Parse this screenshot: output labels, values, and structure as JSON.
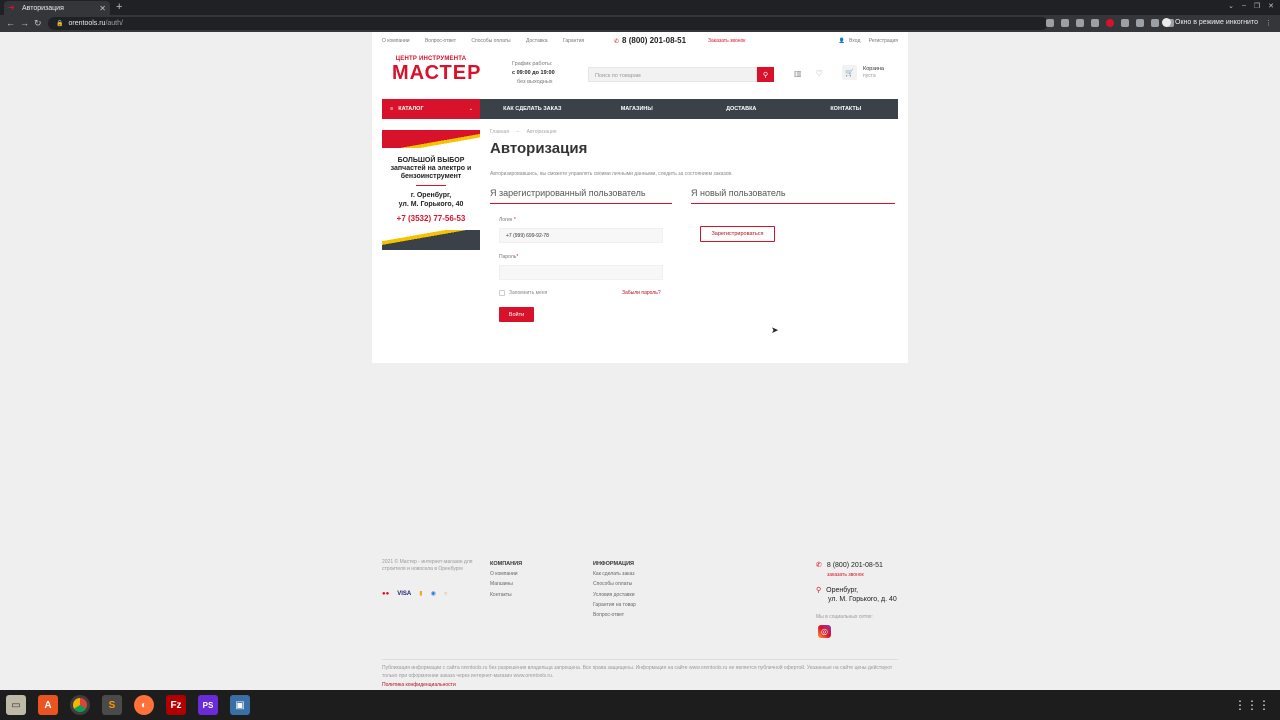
{
  "browser": {
    "tab_title": "Авторизация",
    "url_host": "orentools.ru",
    "url_path": "/auth/",
    "incognito_label": "Окно в режиме инкогнито"
  },
  "topbar": {
    "links": [
      "О компании",
      "Вопрос-ответ",
      "Способы оплаты",
      "Доставка",
      "Гарантия"
    ],
    "phone": "8 (800) 201-08-51",
    "callback": "Заказать звонок",
    "login": "Вход",
    "register": "Регистрация"
  },
  "header": {
    "logo_top": "ЦЕНТР ИНСТРУМЕНТА",
    "logo_main": "МАСТЕР",
    "schedule_title": "График работы:",
    "schedule_hours": "с 09:00 до 19:00",
    "schedule_days": "без выходных",
    "search_placeholder": "Поиск по товарам",
    "cart_label": "Корзина",
    "cart_status": "пуста"
  },
  "nav": {
    "catalog": "КАТАЛОГ",
    "items": [
      "КАК СДЕЛАТЬ ЗАКАЗ",
      "МАГАЗИНЫ",
      "ДОСТАВКА",
      "КОНТАКТЫ"
    ]
  },
  "banner": {
    "line1": "БОЛЬШОЙ ВЫБОР",
    "line2": "запчастей на электро и",
    "line3": "бензоинструмент",
    "city": "г. Оренбург,",
    "address": "ул. М. Горького, 40",
    "phone": "+7 (3532) 77-56-53"
  },
  "breadcrumbs": [
    "Главная",
    "Авторизация"
  ],
  "auth": {
    "title": "Авторизация",
    "intro": "Авторизировавшись, вы сможете управлять своими личными данными, следить за состоянием заказов.",
    "registered_title": "Я зарегистрированный пользователь",
    "new_title": "Я новый пользователь",
    "login_label": "Логин",
    "login_value": "+7 (999) 699-92-78",
    "password_label": "Пароль",
    "remember": "Запомнить меня",
    "forgot": "Забыли пароль?",
    "submit": "Войти",
    "register_button": "Зарегистрироваться"
  },
  "footer": {
    "copyright": "2021 © Мастер - интернет-магазин для строителя и новосела в Оренбурге",
    "company_title": "КОМПАНИЯ",
    "company_links": [
      "О компании",
      "Магазины",
      "Контакты"
    ],
    "info_title": "ИНФОРМАЦИЯ",
    "info_links": [
      "Как сделать заказ",
      "Способы оплаты",
      "Условия доставки",
      "Гарантия на товар",
      "Вопрос-ответ"
    ],
    "phone": "8 (800) 201-08-51",
    "callback": "заказать звонок",
    "city": "Оренбург,",
    "address": "ул. М. Горького, д. 40",
    "social_label": "Мы в социальных сетях:",
    "legal": "Публикация информации с сайта orentools.ru без разрешения владельца запрещена. Все права защищены. Информация на сайте www.orentools.ru не является публичной офертой. Указанные на сайте цены действуют только при оформлении заказа через интернет-магазин www.orentools.ru.",
    "policy": "Политика конфиденциальности",
    "payment_logos": [
      "MasterCard",
      "VISA",
      "Яндекс.Деньги",
      "Webmoney",
      "QIWI"
    ]
  },
  "colors": {
    "brand_red": "#d9122b",
    "nav_dark": "#3b4148"
  }
}
